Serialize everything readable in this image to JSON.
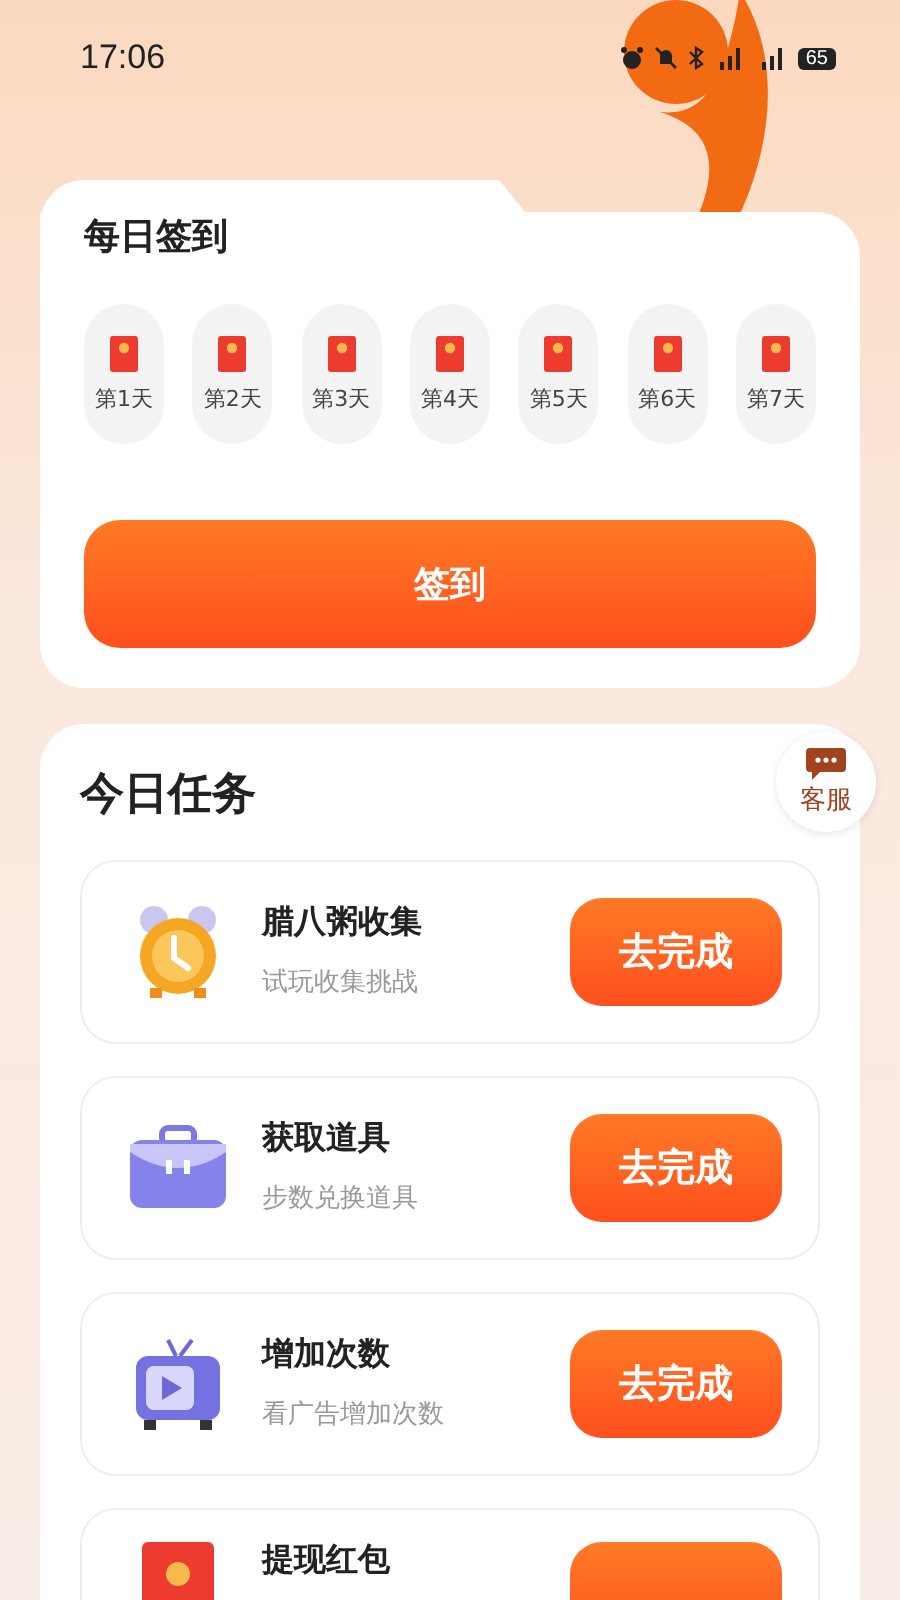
{
  "status_bar": {
    "time": "17:06",
    "battery": "65"
  },
  "checkin": {
    "title": "每日签到",
    "days": [
      {
        "label": "第1天"
      },
      {
        "label": "第2天"
      },
      {
        "label": "第3天"
      },
      {
        "label": "第4天"
      },
      {
        "label": "第5天"
      },
      {
        "label": "第6天"
      },
      {
        "label": "第7天"
      }
    ],
    "button": "签到"
  },
  "support": {
    "label": "客服"
  },
  "tasks": {
    "title": "今日任务",
    "items": [
      {
        "kind": "clock",
        "title": "腊八粥收集",
        "subtitle": "试玩收集挑战",
        "button": "去完成"
      },
      {
        "kind": "briefcase",
        "title": "获取道具",
        "subtitle": "步数兑换道具",
        "button": "去完成"
      },
      {
        "kind": "tv",
        "title": "增加次数",
        "subtitle": "看广告增加次数",
        "button": "去完成"
      },
      {
        "kind": "envelope",
        "title": "提现红包"
      }
    ]
  }
}
